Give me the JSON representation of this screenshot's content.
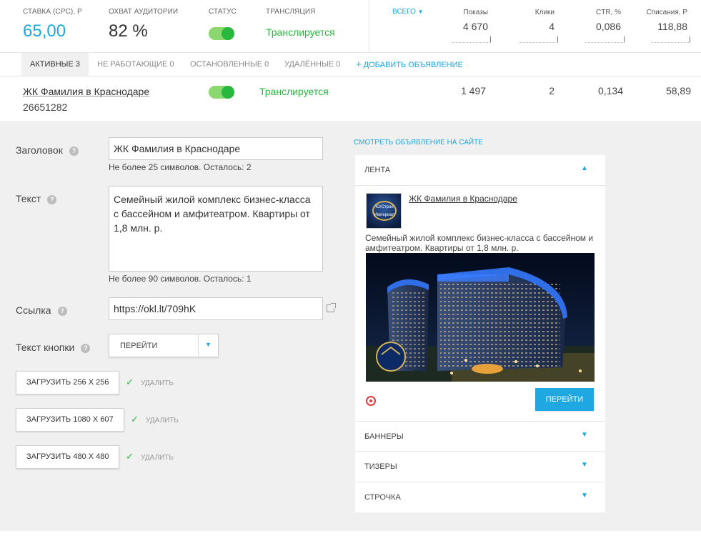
{
  "stats": {
    "bid_label": "Ставка (CPC), Р",
    "bid_value": "65,00",
    "reach_label": "Охват аудитории",
    "reach_value": "82 %",
    "status_label": "Статус",
    "broadcast_label": "Трансляция",
    "broadcast_value": "Транслируется",
    "total_link": "ВСЕГО",
    "metrics": [
      {
        "label": "Показы",
        "value": "4 670"
      },
      {
        "label": "Клики",
        "value": "4"
      },
      {
        "label": "CTR, %",
        "value": "0,086"
      },
      {
        "label": "Списания, Р",
        "value": "118,88"
      }
    ]
  },
  "tabs": {
    "active": "Активные 3",
    "not_working": "Не работающие 0",
    "stopped": "Остановленные 0",
    "deleted": "Удалённые 0",
    "add": "Добавить объявление"
  },
  "ad": {
    "title": "ЖК Фамилия в Краснодаре",
    "id": "26651282",
    "status": "Транслируется",
    "shows": "1 497",
    "clicks": "2",
    "ctr": "0,134",
    "spend": "58,89"
  },
  "form": {
    "title_label": "Заголовок",
    "title_value": "ЖК Фамилия в Краснодаре",
    "title_hint": "Не более 25 символов. Осталось: 2",
    "text_label": "Текст",
    "text_value": "Семейный жилой комплекс бизнес-класса с бассейном и амфитеатром. Квартиры от 1,8 млн. р.",
    "text_hint": "Не более 90 символов. Осталось: 1",
    "link_label": "Ссылка",
    "link_value": "https://okl.lt/709hK",
    "button_label": "Текст кнопки",
    "button_value": "ПЕРЕЙТИ",
    "uploads": [
      {
        "label": "Загрузить 256 x 256",
        "delete": "Удалить"
      },
      {
        "label": "Загрузить 1080 x 607",
        "delete": "Удалить"
      },
      {
        "label": "Загрузить 480 x 480",
        "delete": "Удалить"
      }
    ]
  },
  "preview": {
    "view_link": "Смотреть объявление на сайте",
    "feed": "Лента",
    "title": "ЖК Фамилия в Краснодаре",
    "text": "Семейный жилой комплекс бизнес-класса с бассейном и амфитеатром. Квартиры от 1,8 млн. р.",
    "logo_text": "ЮгСтрой Империал",
    "go": "Перейти",
    "banners": "Баннеры",
    "teasers": "Тизеры",
    "line": "Строчка"
  },
  "colors": {
    "accent": "#1ea7e1",
    "success": "#2ab73e",
    "editor_bg": "#f0f0f0"
  }
}
